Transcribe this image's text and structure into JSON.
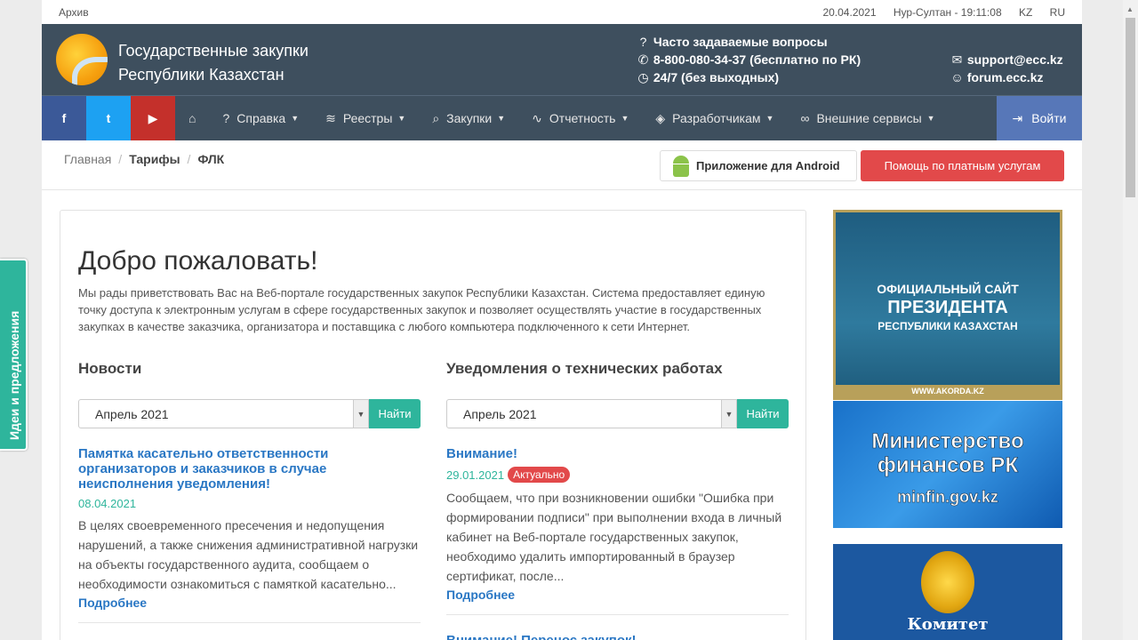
{
  "topbar": {
    "archive": "Архив",
    "date": "20.04.2021",
    "time": "Нур-Султан - 19:11:08",
    "lang_kz": "KZ",
    "lang_ru": "RU"
  },
  "header": {
    "title_line1": "Государственные закупки",
    "title_line2": "Республики Казахстан",
    "faq": "Часто задаваемые вопросы",
    "phone": "8-800-080-34-37 (бесплатно по РК)",
    "hours": "24/7 (без выходных)",
    "email": "support@ecc.kz",
    "forum": "forum.ecc.kz"
  },
  "nav": {
    "social": {
      "facebook": "f",
      "twitter": "t",
      "youtube": "▶"
    },
    "items": [
      "Справка",
      "Реестры",
      "Закупки",
      "Отчетность",
      "Разработчикам",
      "Внешние сервисы"
    ],
    "login": "Войти"
  },
  "breadcrumb": {
    "home": "Главная",
    "tariffs": "Тарифы",
    "current": "ФЛК"
  },
  "buttons": {
    "android": "Приложение для Android",
    "help": "Помощь по платным услугам"
  },
  "main": {
    "title": "Добро пожаловать!",
    "intro": "Мы рады приветствовать Вас на Веб-портале государственных закупок Республики Казахстан. Система предоставляет единую точку доступа к электронным услугам в сфере государственных закупок и позволяет осуществлять участие в государственных закупках в качестве заказчика, организатора и поставщика с любого компьютера подключенного к сети Интернет."
  },
  "news": {
    "heading": "Новости",
    "select_value": "Апрель 2021",
    "find": "Найти",
    "item": {
      "title": "Памятка касательно ответственности организаторов и заказчиков в случае неисполнения уведомления!",
      "date": "08.04.2021",
      "text": "В целях своевременного пресечения и недопущения нарушений, а также снижения административной нагрузки на объекты государственного аудита, сообщаем о необходимости ознакомиться с памяткой касательно...",
      "more": "Подробнее"
    }
  },
  "notices": {
    "heading": "Уведомления о технических работах",
    "select_value": "Апрель 2021",
    "find": "Найти",
    "item": {
      "title": "Внимание!",
      "date": "29.01.2021",
      "badge": "Актуально",
      "text": "Сообщаем, что при возникновении ошибки \"Ошибка при формировании подписи\" при выполнении входа в личный кабинет на Веб-портале государственных закупок, необходимо удалить импортированный в браузер сертификат, после...",
      "more": "Подробнее"
    },
    "next_title": "Внимание! Перенос закупок!"
  },
  "banners": {
    "president": {
      "line1": "ОФИЦИАЛЬНЫЙ САЙТ",
      "line2": "ПРЕЗИДЕНТА",
      "line3": "РЕСПУБЛИКИ КАЗАХСТАН",
      "site": "WWW.AKORDA.KZ"
    },
    "minfin": {
      "line1": "Министерство",
      "line2": "финансов РК",
      "site": "minfin.gov.kz"
    },
    "committee": {
      "line1": "Комитет"
    }
  },
  "sidetab": {
    "label": "Идеи и предложения"
  }
}
